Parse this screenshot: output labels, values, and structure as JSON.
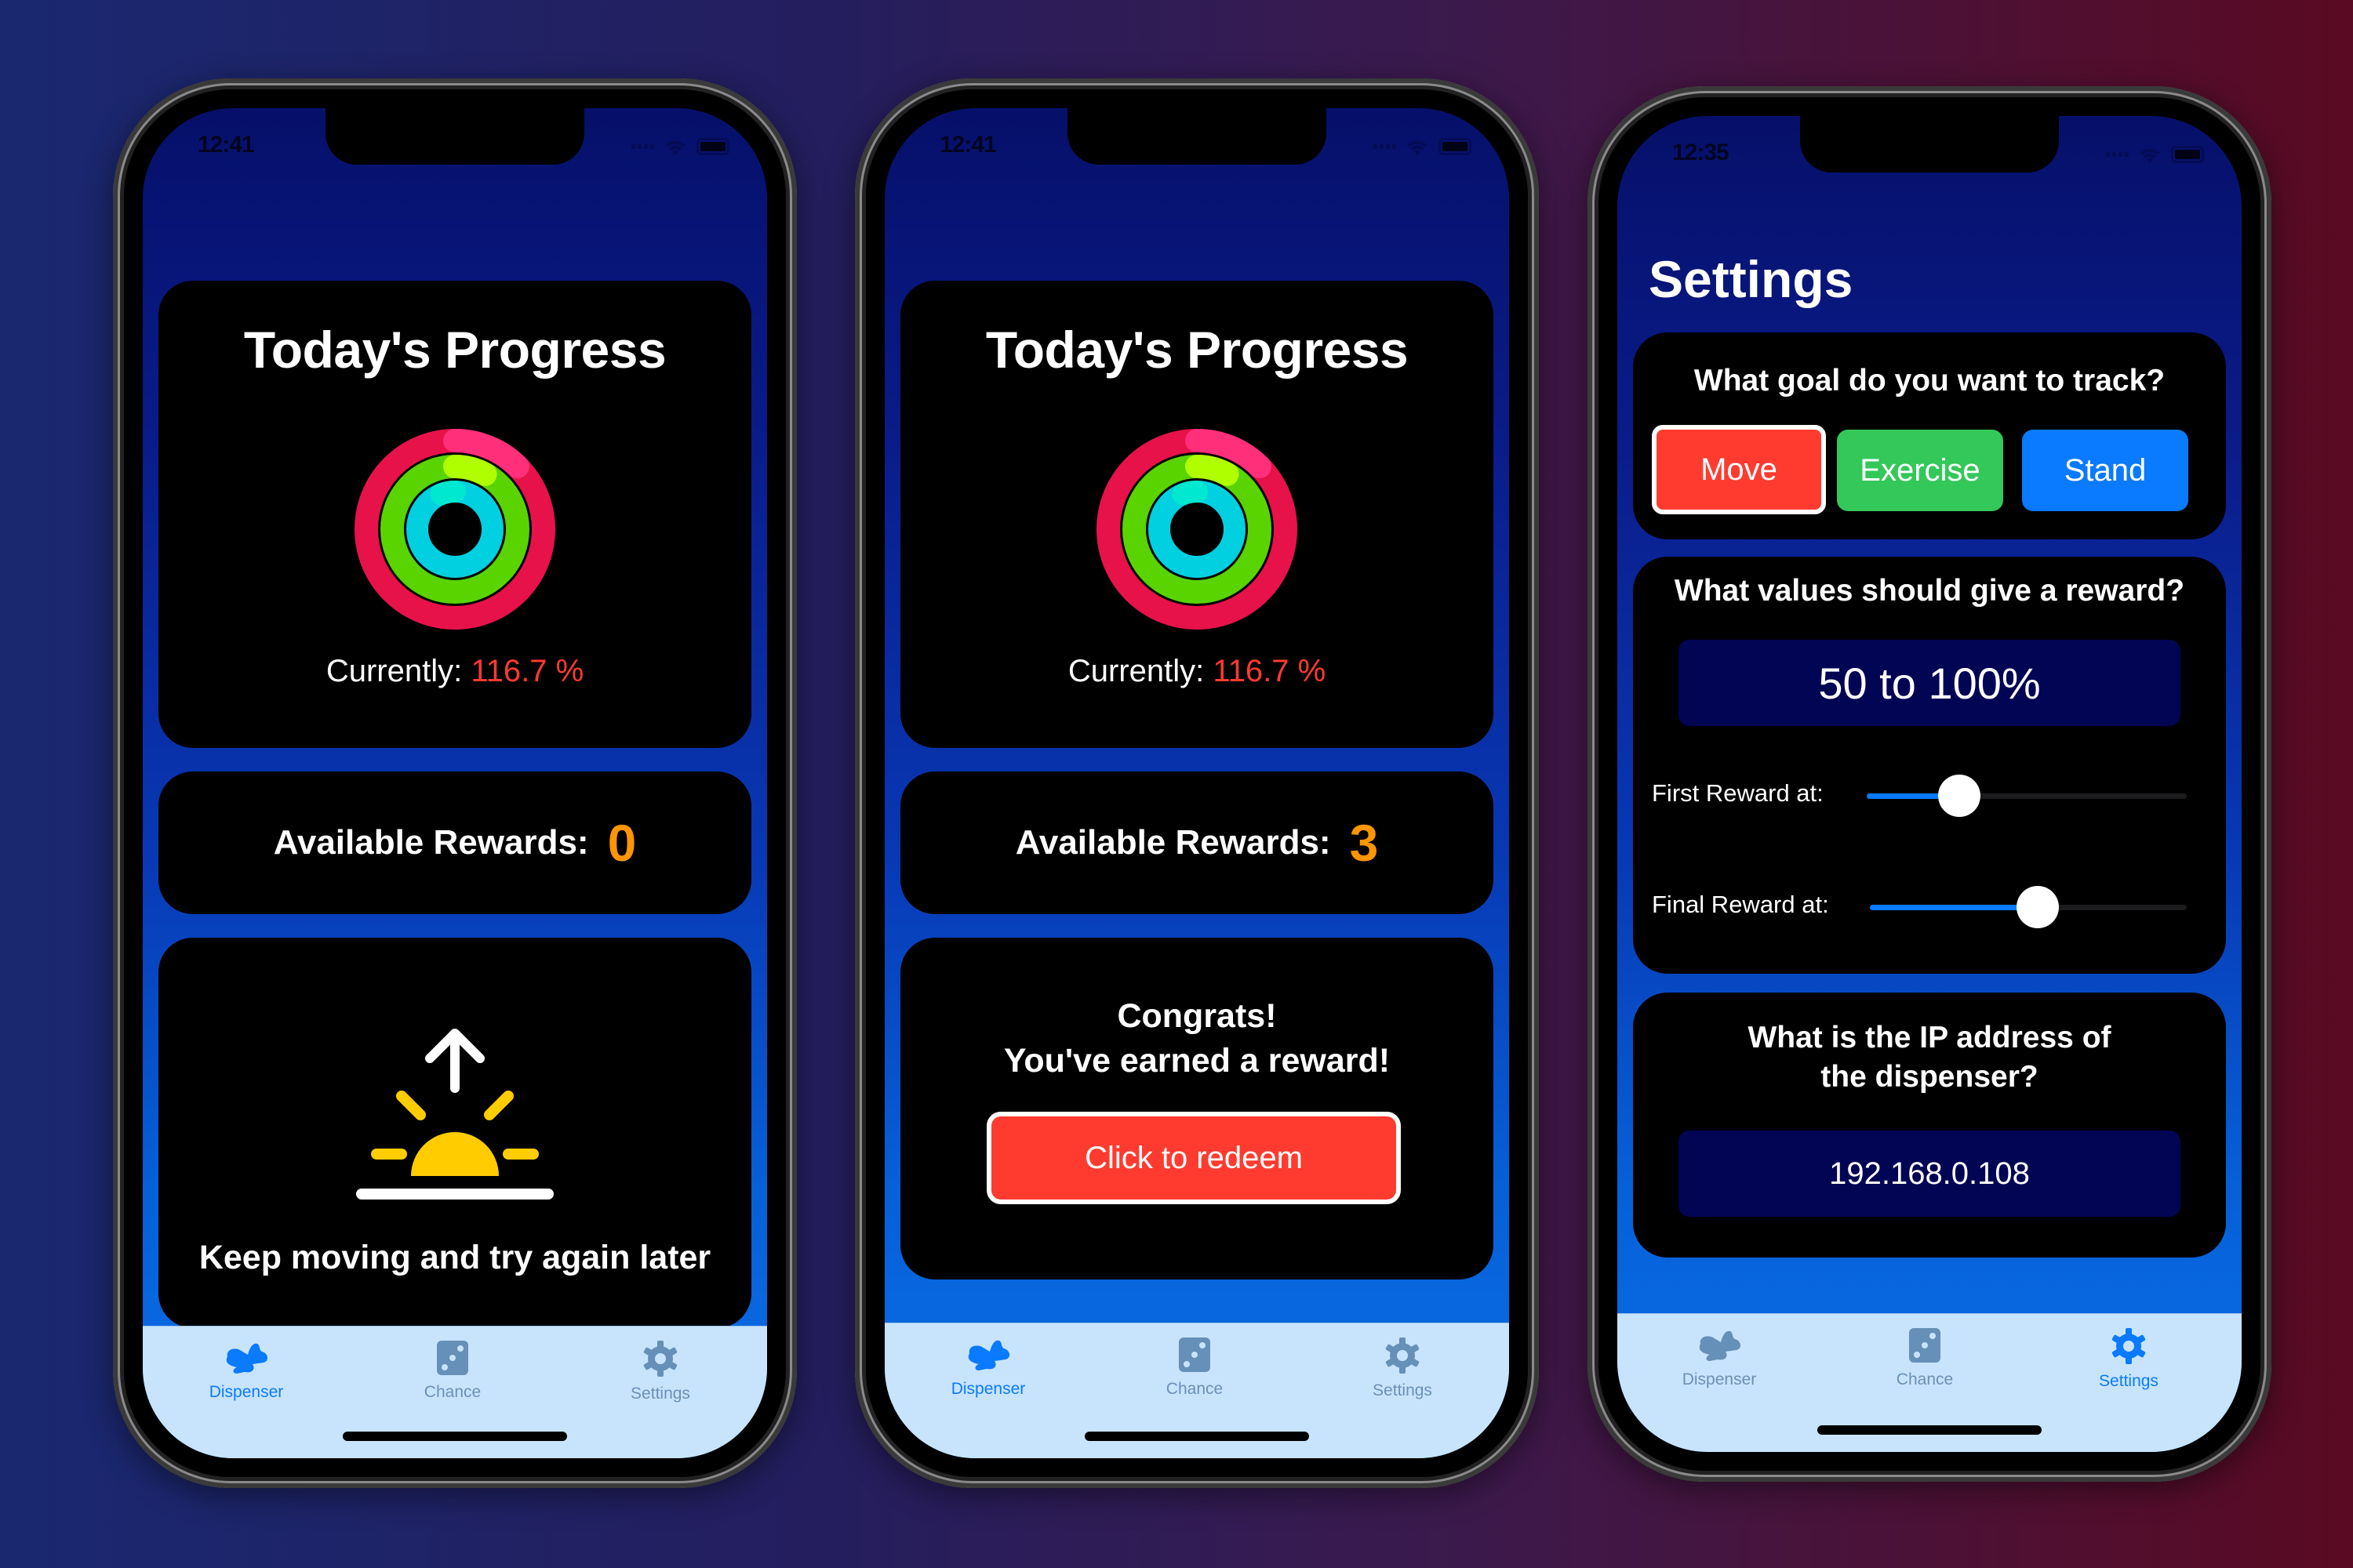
{
  "colors": {
    "accent": "#0a7aff",
    "progress_value": "#ff3b30",
    "rewards_value": "#ff9500",
    "move": "#ff3b30",
    "exercise": "#34c759",
    "stand": "#0a7aff",
    "tab_bar": "#c8e4fc"
  },
  "tabs": [
    {
      "label": "Dispenser",
      "icon": "rabbit-icon"
    },
    {
      "label": "Chance",
      "icon": "die-icon"
    },
    {
      "label": "Settings",
      "icon": "gear-icon"
    }
  ],
  "phones": [
    {
      "status_time": "12:41",
      "progress": {
        "title": "Today's Progress",
        "currently_label": "Currently:",
        "currently_value": "116.7 %"
      },
      "rewards": {
        "label": "Available Rewards:",
        "value": "0"
      },
      "message": {
        "icon": "sunrise-icon",
        "text": "Keep moving and try again later"
      },
      "active_tab": "Dispenser"
    },
    {
      "status_time": "12:41",
      "progress": {
        "title": "Today's Progress",
        "currently_label": "Currently:",
        "currently_value": "116.7 %"
      },
      "rewards": {
        "label": "Available Rewards:",
        "value": "3"
      },
      "message": {
        "line1": "Congrats!",
        "line2": "You've earned a reward!",
        "button": "Click to redeem"
      },
      "active_tab": "Dispenser"
    },
    {
      "status_time": "12:35",
      "title": "Settings",
      "goal": {
        "question": "What goal do you want to track?",
        "options": [
          "Move",
          "Exercise",
          "Stand"
        ],
        "selected": "Move"
      },
      "reward_values": {
        "question": "What values should give a reward?",
        "range_display": "50 to 100%",
        "first_label": "First Reward at:",
        "first_value_fraction": 0.29,
        "final_label": "Final Reward at:",
        "final_value_fraction": 0.53
      },
      "ip": {
        "question_line1": "What is the IP address of",
        "question_line2": "the dispenser?",
        "value": "192.168.0.108"
      },
      "active_tab": "Settings"
    }
  ]
}
